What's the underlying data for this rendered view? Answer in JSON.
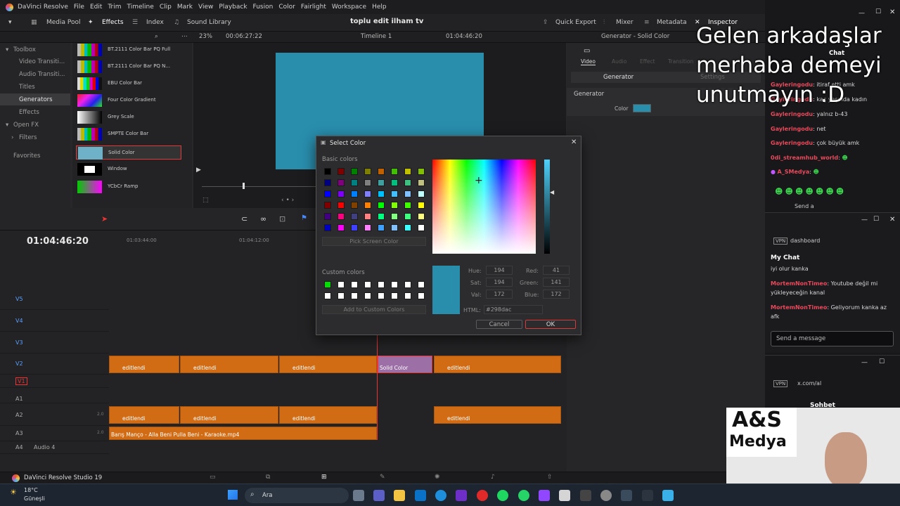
{
  "app": {
    "title": "DaVinci Resolve",
    "menus": [
      "File",
      "Edit",
      "Trim",
      "Timeline",
      "Clip",
      "Mark",
      "View",
      "Playback",
      "Fusion",
      "Color",
      "Fairlight",
      "Workspace",
      "Help"
    ],
    "project_name": "toplu edit ilham tv",
    "brand": "DaVinci Resolve Studio 19"
  },
  "toolbar": {
    "media_pool": "Media Pool",
    "effects": "Effects",
    "index": "Index",
    "sound_library": "Sound Library",
    "quick_export": "Quick Export",
    "mixer": "Mixer",
    "metadata": "Metadata",
    "inspector": "Inspector"
  },
  "subbar": {
    "zoom": "23%",
    "timecode": "00:06:27:22",
    "timeline_name": "Timeline 1",
    "timecode_right": "01:04:46:20",
    "inspector_title": "Generator - Solid Color"
  },
  "left_panel": {
    "toolbox": "Toolbox",
    "video_transitions": "Video Transiti...",
    "audio_transitions": "Audio Transiti...",
    "titles": "Titles",
    "generators": "Generators",
    "effects": "Effects",
    "open_fx": "Open FX",
    "filters": "Filters",
    "favorites": "Favorites"
  },
  "generators": [
    "BT.2111 Color Bar PQ Full",
    "BT.2111 Color Bar PQ N...",
    "EBU Color Bar",
    "Four Color Gradient",
    "Grey Scale",
    "SMPTE Color Bar",
    "Solid Color",
    "Window",
    "YCbCr Ramp"
  ],
  "inspector": {
    "tabs": [
      "Video",
      "Audio",
      "Effect",
      "Transition"
    ],
    "sub_tabs": [
      "Generator",
      "Settings"
    ],
    "section": "Generator",
    "color_label": "Color",
    "color_value": "#298dac"
  },
  "timeline": {
    "timecode": "01:04:46:20",
    "ruler": [
      "01:03:44:00",
      "01:04:12:00"
    ],
    "video_tracks": [
      "V5",
      "V4",
      "V3",
      "V2",
      "V1"
    ],
    "audio_tracks": [
      "A1",
      "A2",
      "A3",
      "A4"
    ],
    "audio4_label": "Audio 4",
    "audio_level": "2.0",
    "clip_label": "editlendi",
    "solid_clip": "Solid Color",
    "audio_clip": "Barış Manço - Alla Beni Pulla Beni - Karaoke.mp4"
  },
  "dialog": {
    "title": "Select Color",
    "basic_colors": "Basic colors",
    "pick_screen": "Pick Screen Color",
    "custom_colors": "Custom colors",
    "add_custom": "Add to Custom Colors",
    "hue_label": "Hue:",
    "hue": "194",
    "sat_label": "Sat:",
    "sat": "194",
    "val_label": "Val:",
    "val": "172",
    "red_label": "Red:",
    "red": "41",
    "green_label": "Green:",
    "green": "141",
    "blue_label": "Blue:",
    "blue": "172",
    "html_label": "HTML:",
    "html": "#298dac",
    "cancel": "Cancel",
    "ok": "OK",
    "current_color": "#298dac"
  },
  "overlay_text": [
    "Gelen arkadaşlar",
    "merhaba demeyi",
    "unutmayın :D"
  ],
  "chat1": {
    "header": "Chat",
    "lines": [
      {
        "user": "Gayleringodu",
        "msg": "itiraf etti amk"
      },
      {
        "user": "Gayleringodu",
        "msg": "kaç yaşında kadın"
      },
      {
        "user": "Gayleringodu",
        "msg": "yalnız b-43"
      },
      {
        "user": "Gayleringodu",
        "msg": "net"
      },
      {
        "user": "Gayleringodu",
        "msg": "çok büyük amk"
      },
      {
        "user": "0di_streamhub_world",
        "msg": ""
      },
      {
        "user": "A_SMedya",
        "msg": ""
      }
    ],
    "send": "Send a"
  },
  "chat2": {
    "vpn": "VPN",
    "url": "dashboard",
    "header": "My Chat",
    "lines": [
      {
        "user": "",
        "msg": "iyi olur kanka"
      },
      {
        "user": "MortemNonTimeo",
        "msg": "Youtube değil mi yükleyeceğin kanal"
      },
      {
        "user": "MortemNonTimeo",
        "msg": "Geliyorum kanka az afk"
      }
    ],
    "placeholder": "Send a message"
  },
  "chat3": {
    "vpn": "VPN",
    "url": "x.com/al",
    "header": "Sohbet"
  },
  "webcam": {
    "logo_top": "A&S",
    "logo_bottom": "Medya"
  },
  "taskbar": {
    "weather_temp": "18°C",
    "weather_desc": "Güneşli",
    "search": "Ara"
  }
}
